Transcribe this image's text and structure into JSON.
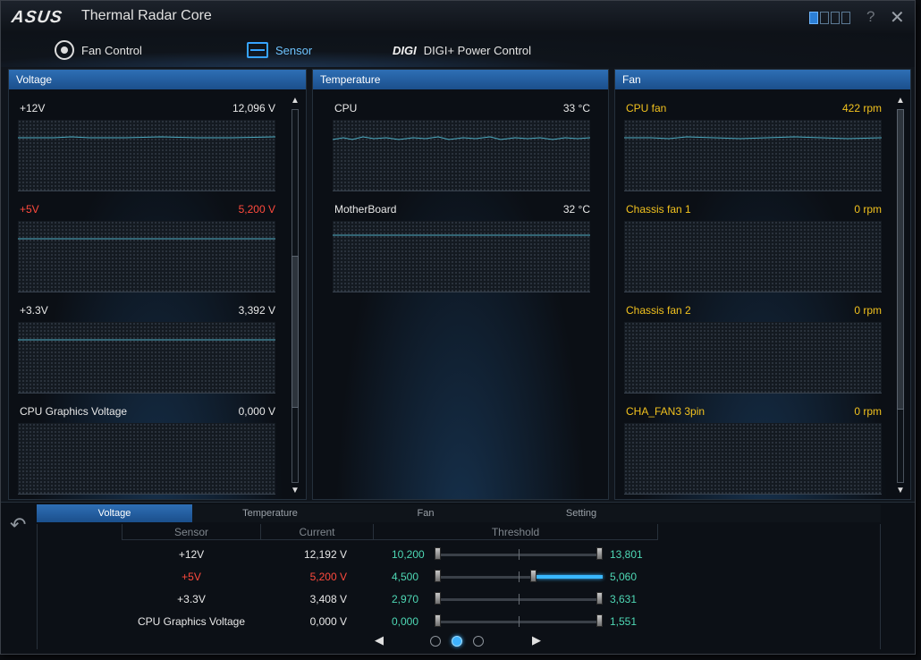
{
  "app": {
    "brand": "ASUS",
    "title": "Thermal Radar Core",
    "help": "?",
    "close": "✕"
  },
  "top_tabs": [
    {
      "label": "Fan Control",
      "icon": "fan-icon"
    },
    {
      "label": "Sensor",
      "icon": "sensor-icon",
      "active": true
    },
    {
      "label": "DIGI+ Power Control",
      "icon": "digi-icon",
      "icon_text": "DIGI"
    }
  ],
  "panels": {
    "voltage": {
      "header": "Voltage",
      "items": [
        {
          "label": "+12V",
          "value": "12,096 V",
          "color": "#e8e8e8",
          "trace_level": 0.3
        },
        {
          "label": "+5V",
          "value": "5,200 V",
          "color": "#ff4a3d",
          "trace_level": 0.3
        },
        {
          "label": "+3.3V",
          "value": "3,392 V",
          "color": "#e8e8e8",
          "trace_level": 0.3
        },
        {
          "label": "CPU Graphics Voltage",
          "value": "0,000 V",
          "color": "#e8e8e8",
          "trace_level": null
        }
      ]
    },
    "temperature": {
      "header": "Temperature",
      "items": [
        {
          "label": "CPU",
          "value": "33 °C"
        },
        {
          "label": "MotherBoard",
          "value": "32 °C"
        }
      ]
    },
    "fan": {
      "header": "Fan",
      "items": [
        {
          "label": "CPU fan",
          "value": "422 rpm"
        },
        {
          "label": "Chassis fan 1",
          "value": "0 rpm"
        },
        {
          "label": "Chassis fan 2",
          "value": "0 rpm"
        },
        {
          "label": "CHA_FAN3 3pin",
          "value": "0 rpm"
        }
      ]
    }
  },
  "bottom": {
    "tabs": [
      "Voltage",
      "Temperature",
      "Fan",
      "Setting"
    ],
    "active_tab": "Voltage",
    "columns": {
      "sensor": "Sensor",
      "current": "Current",
      "threshold": "Threshold"
    },
    "rows": [
      {
        "name": "+12V",
        "current": "12,192 V",
        "min": "10,200",
        "max": "13,801",
        "alert": false
      },
      {
        "name": "+5V",
        "current": "5,200 V",
        "min": "4,500",
        "max": "5,060",
        "alert": true
      },
      {
        "name": "+3.3V",
        "current": "3,408 V",
        "min": "2,970",
        "max": "3,631",
        "alert": false
      },
      {
        "name": "CPU Graphics Voltage",
        "current": "0,000 V",
        "min": "0,000",
        "max": "1,551",
        "alert": false
      }
    ],
    "pager": {
      "prev": "◀",
      "next": "▶",
      "pages": 3,
      "current_page": 2
    }
  },
  "colors": {
    "accent": "#2e6fb5",
    "alert": "#ff4a3d",
    "fan": "#f2c21e",
    "threshold": "#4ed8b5",
    "trace": "#4fb0c6"
  }
}
